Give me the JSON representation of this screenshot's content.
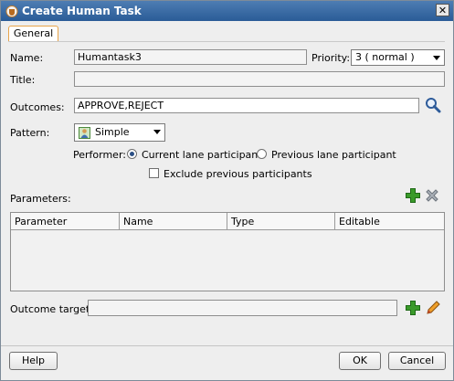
{
  "window": {
    "title": "Create Human Task",
    "close_icon": "close-icon"
  },
  "tabs": [
    {
      "label": "General"
    }
  ],
  "form": {
    "name_label": "Name:",
    "name_value": "Humantask3",
    "priority_label": "Priority:",
    "priority_value": "3 ( normal )",
    "title_label": "Title:",
    "title_value": "",
    "outcomes_label": "Outcomes:",
    "outcomes_value": "APPROVE,REJECT",
    "pattern_label": "Pattern:",
    "pattern_value": "Simple",
    "performer_label": "Performer:",
    "performer_options": [
      {
        "label": "Current lane participant",
        "selected": true
      },
      {
        "label": "Previous lane participant",
        "selected": false
      }
    ],
    "exclude_label": "Exclude previous participants",
    "exclude_checked": false,
    "parameters_label": "Parameters:",
    "outcome_target_label": "Outcome target:",
    "outcome_target_value": ""
  },
  "parameters_table": {
    "columns": [
      "Parameter",
      "Name",
      "Type",
      "Editable"
    ],
    "rows": []
  },
  "buttons": {
    "help": "Help",
    "ok": "OK",
    "cancel": "Cancel"
  },
  "colors": {
    "titlebar": "#2a5c97",
    "tab_border": "#e8a44a",
    "add_icon": "#3a9a2a"
  }
}
